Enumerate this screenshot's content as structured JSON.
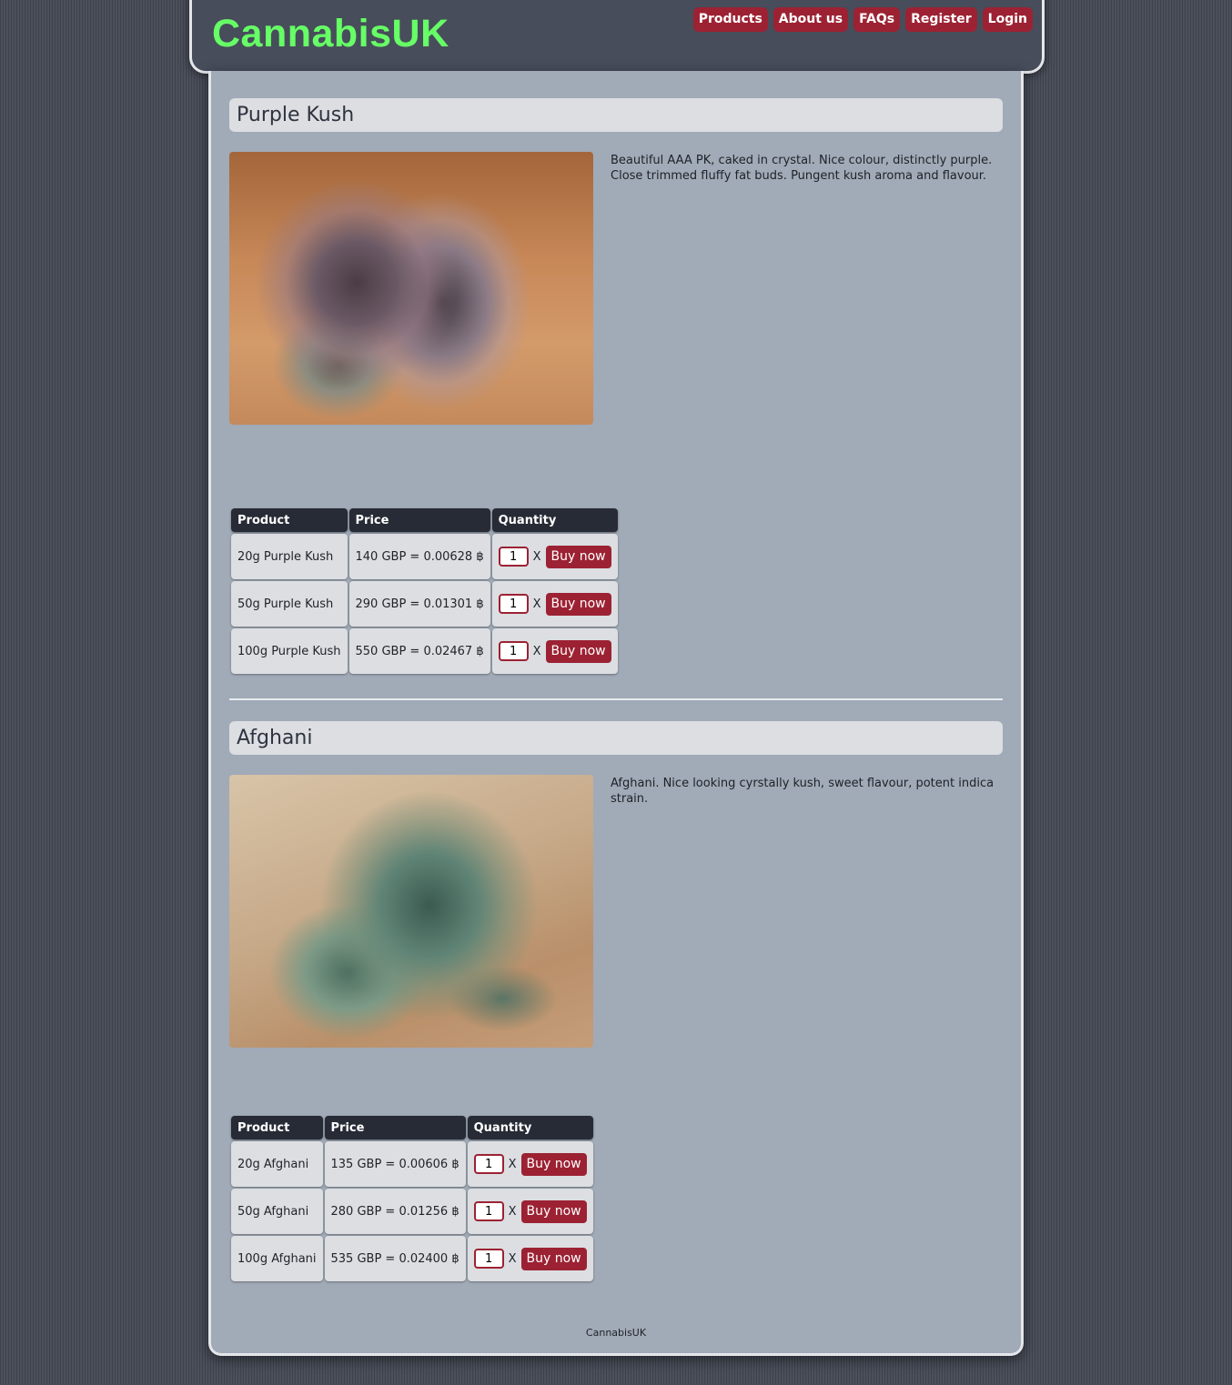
{
  "header": {
    "logo": "CannabisUK",
    "nav": [
      "Products",
      "About us",
      "FAQs",
      "Register",
      "Login"
    ]
  },
  "table_headers": {
    "product": "Product",
    "price": "Price",
    "quantity": "Quantity"
  },
  "qty_separator": "X",
  "buy_label": "Buy now",
  "products": [
    {
      "name": "Purple Kush",
      "description": "Beautiful AAA PK, caked in crystal. Nice colour, distinctly purple. Close trimmed fluffy fat buds. Pungent kush aroma and flavour.",
      "rows": [
        {
          "product": "20g Purple Kush",
          "price": "140 GBP = 0.00628 ฿",
          "qty": "1"
        },
        {
          "product": "50g Purple Kush",
          "price": "290 GBP = 0.01301 ฿",
          "qty": "1"
        },
        {
          "product": "100g Purple Kush",
          "price": "550 GBP = 0.02467 ฿",
          "qty": "1"
        }
      ]
    },
    {
      "name": "Afghani",
      "description": "Afghani. Nice looking cyrstally kush, sweet flavour, potent indica strain.",
      "rows": [
        {
          "product": "20g Afghani",
          "price": "135 GBP = 0.00606 ฿",
          "qty": "1"
        },
        {
          "product": "50g Afghani",
          "price": "280 GBP = 0.01256 ฿",
          "qty": "1"
        },
        {
          "product": "100g Afghani",
          "price": "535 GBP = 0.02400 ฿",
          "qty": "1"
        }
      ]
    }
  ],
  "footer": "CannabisUK"
}
